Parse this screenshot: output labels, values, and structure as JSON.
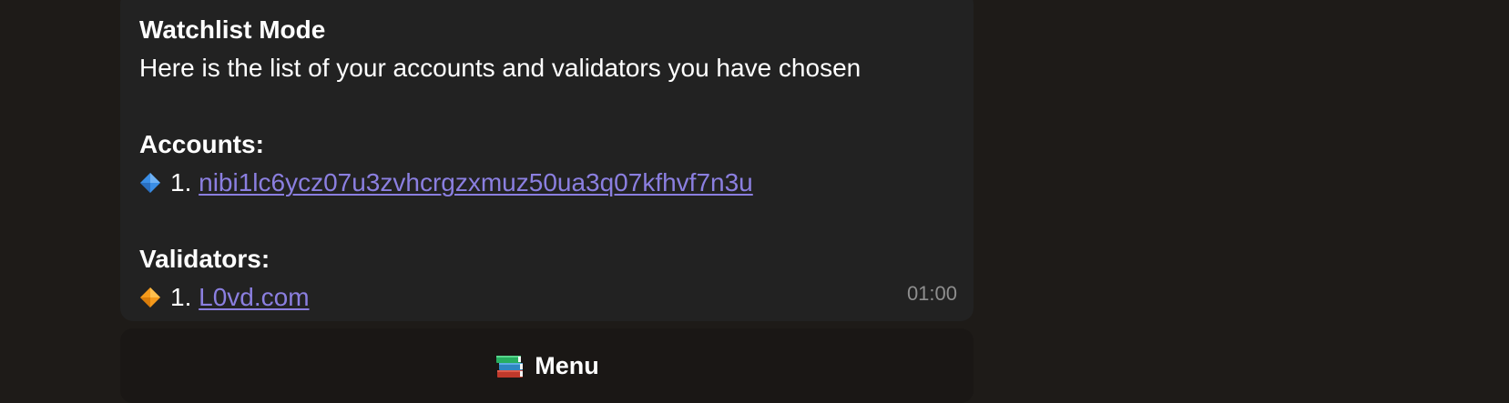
{
  "message": {
    "title": "Watchlist Mode",
    "subtitle": "Here is the list of your accounts and validators you have chosen",
    "accounts": {
      "heading": "Accounts:",
      "items": [
        {
          "index": "1.",
          "label": "nibi1lc6ycz07u3zvhcrgzxmuz50ua3q07kfhvf7n3u",
          "icon": "blue-diamond-icon",
          "color": "#3a8ee6"
        }
      ]
    },
    "validators": {
      "heading": "Validators:",
      "items": [
        {
          "index": "1.",
          "label": "L0vd.com",
          "icon": "orange-diamond-icon",
          "color": "#f59a1b"
        }
      ]
    },
    "time": "01:00"
  },
  "keyboard": {
    "menu_label": "Menu",
    "menu_icon": "books-icon"
  },
  "colors": {
    "background": "#1e1b18",
    "bubble": "#222222",
    "link": "#8b7fe0",
    "button": "#1a1715",
    "timestamp": "#8e8e8e"
  }
}
